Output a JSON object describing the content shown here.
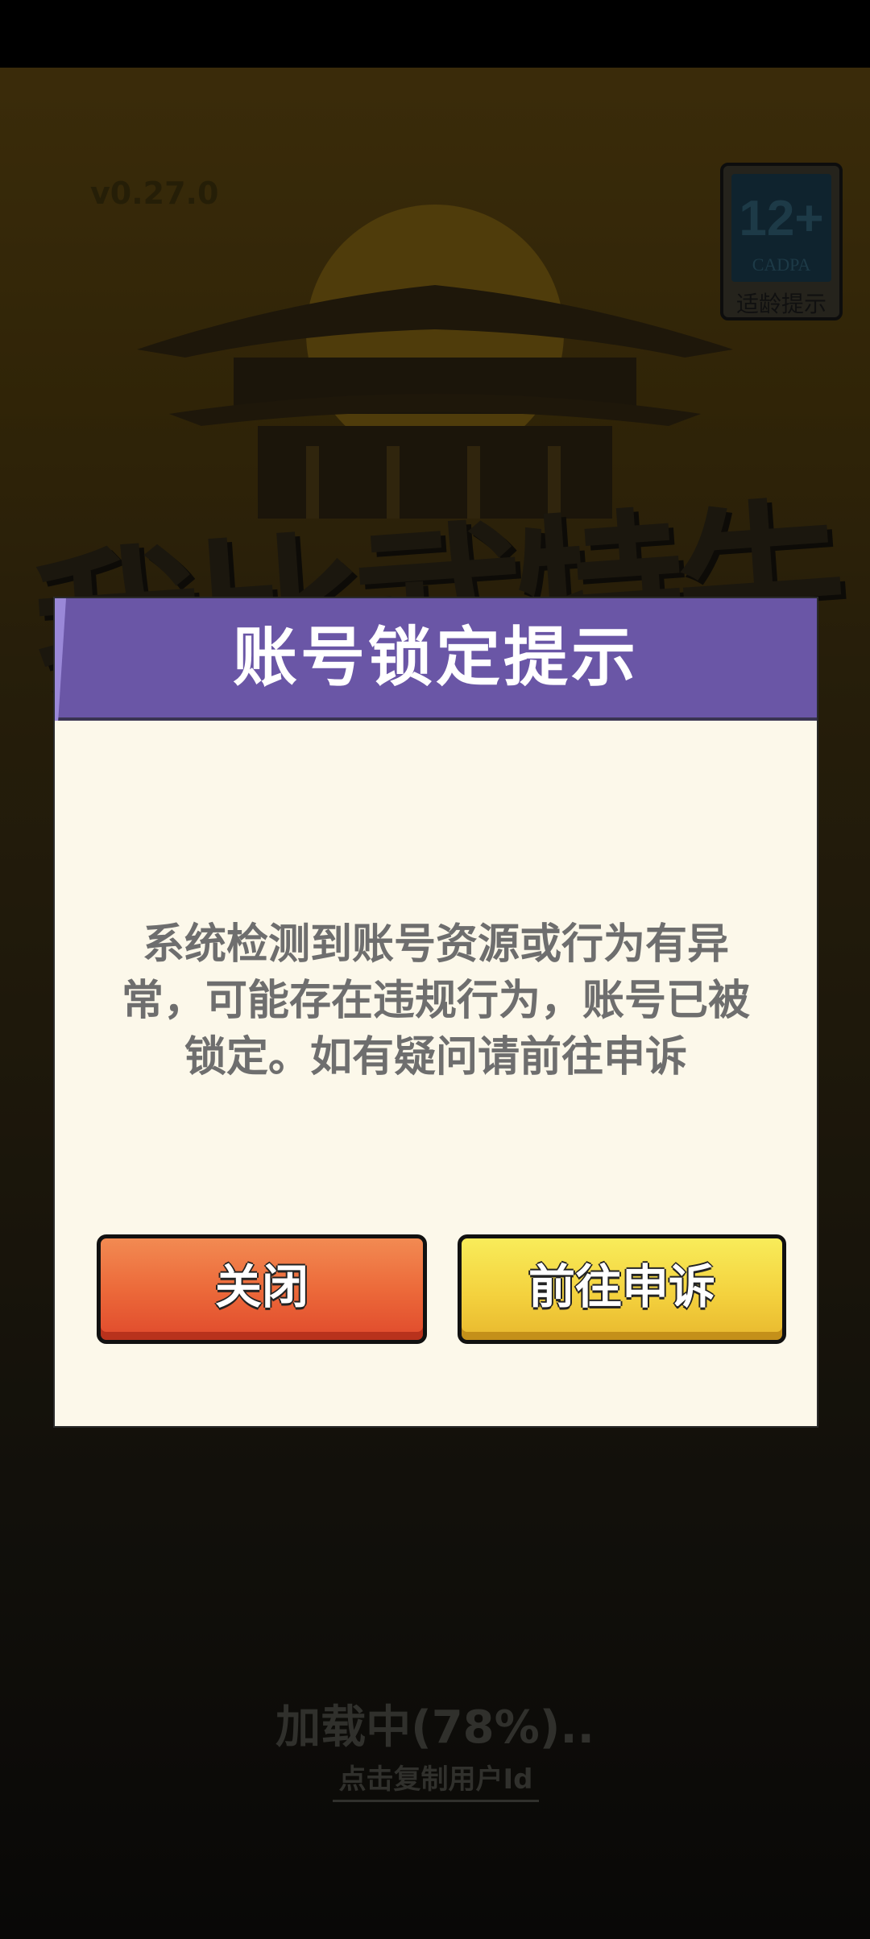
{
  "game": {
    "version": "v0.27.0",
    "logo_title": "我比武特牛",
    "age_rating": {
      "number": "12+",
      "org": "CADPA",
      "label": "适龄提示"
    },
    "loading_text": "加载中(78%)..",
    "copy_user_id_link": "点击复制用户Id"
  },
  "dialog": {
    "title": "账号锁定提示",
    "message": "系统检测到账号资源或行为有异常，可能存在违规行为，账号已被锁定。如有疑问请前往申诉",
    "close_button": "关闭",
    "appeal_button": "前往申诉"
  },
  "colors": {
    "dialog_header": "#6a56a6",
    "dialog_body": "#fcf8ea",
    "close_button": "#ec6a3a",
    "appeal_button": "#f4d23e"
  }
}
